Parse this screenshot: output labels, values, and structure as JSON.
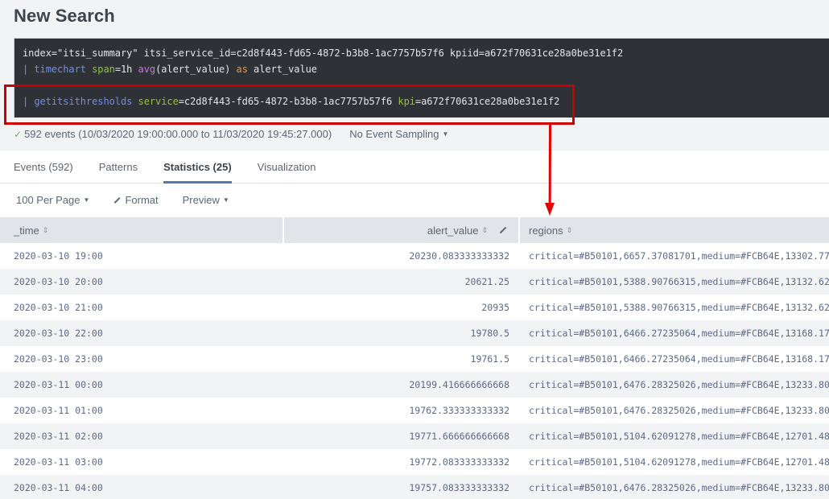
{
  "page": {
    "title": "New Search"
  },
  "search": {
    "line1": {
      "text": "index=\"itsi_summary\" itsi_service_id=c2d8f443-fd65-4872-b3b8-1ac7757b57f6 kpiid=a672f70631ce28a0be31e1f2"
    },
    "line2": {
      "pipe": "| ",
      "cmd": "timechart",
      "sp1": " ",
      "arg": "span",
      "val": "=1h ",
      "fn": "avg",
      "fnargs": "(alert_value) ",
      "as": "as",
      "rest": " alert_value"
    },
    "line3": {
      "pipe": "| ",
      "cmd": "getitsithresholds",
      "sp1": " ",
      "arg1": "service",
      "val1": "=c2d8f443-fd65-4872-b3b8-1ac7757b57f6 ",
      "arg2": "kpi",
      "val2": "=a672f70631ce28a0be31e1f2"
    }
  },
  "annotation": {
    "color": "#CC0000"
  },
  "status": {
    "check": "✓",
    "events_text": "592 events (10/03/2020 19:00:00.000 to 11/03/2020 19:45:27.000)",
    "sampling_label": "No Event Sampling",
    "caret": "▼"
  },
  "tabs": [
    {
      "label": "Events (592)",
      "active": false
    },
    {
      "label": "Patterns",
      "active": false
    },
    {
      "label": "Statistics (25)",
      "active": true
    },
    {
      "label": "Visualization",
      "active": false
    }
  ],
  "toolbar": {
    "per_page": "100 Per Page",
    "format": "Format",
    "preview": "Preview",
    "caret": "▼"
  },
  "table": {
    "columns": [
      "_time",
      "alert_value",
      "regions"
    ],
    "sort_glyph": "⇕",
    "rows": [
      {
        "time": "2020-03-10 19:00",
        "alert_value": "20230.083333333332",
        "regions": "critical=#B50101,6657.37081701,medium=#FCB64E,13302.77"
      },
      {
        "time": "2020-03-10 20:00",
        "alert_value": "20621.25",
        "regions": "critical=#B50101,5388.90766315,medium=#FCB64E,13132.62"
      },
      {
        "time": "2020-03-10 21:00",
        "alert_value": "20935",
        "regions": "critical=#B50101,5388.90766315,medium=#FCB64E,13132.62"
      },
      {
        "time": "2020-03-10 22:00",
        "alert_value": "19780.5",
        "regions": "critical=#B50101,6466.27235064,medium=#FCB64E,13168.17"
      },
      {
        "time": "2020-03-10 23:00",
        "alert_value": "19761.5",
        "regions": "critical=#B50101,6466.27235064,medium=#FCB64E,13168.17"
      },
      {
        "time": "2020-03-11 00:00",
        "alert_value": "20199.416666666668",
        "regions": "critical=#B50101,6476.28325026,medium=#FCB64E,13233.80"
      },
      {
        "time": "2020-03-11 01:00",
        "alert_value": "19762.333333333332",
        "regions": "critical=#B50101,6476.28325026,medium=#FCB64E,13233.80"
      },
      {
        "time": "2020-03-11 02:00",
        "alert_value": "19771.666666666668",
        "regions": "critical=#B50101,5104.62091278,medium=#FCB64E,12701.48"
      },
      {
        "time": "2020-03-11 03:00",
        "alert_value": "19772.083333333332",
        "regions": "critical=#B50101,5104.62091278,medium=#FCB64E,12701.48"
      },
      {
        "time": "2020-03-11 04:00",
        "alert_value": "19757.083333333332",
        "regions": "critical=#B50101,6476.28325026,medium=#FCB64E,13233.80"
      }
    ]
  }
}
